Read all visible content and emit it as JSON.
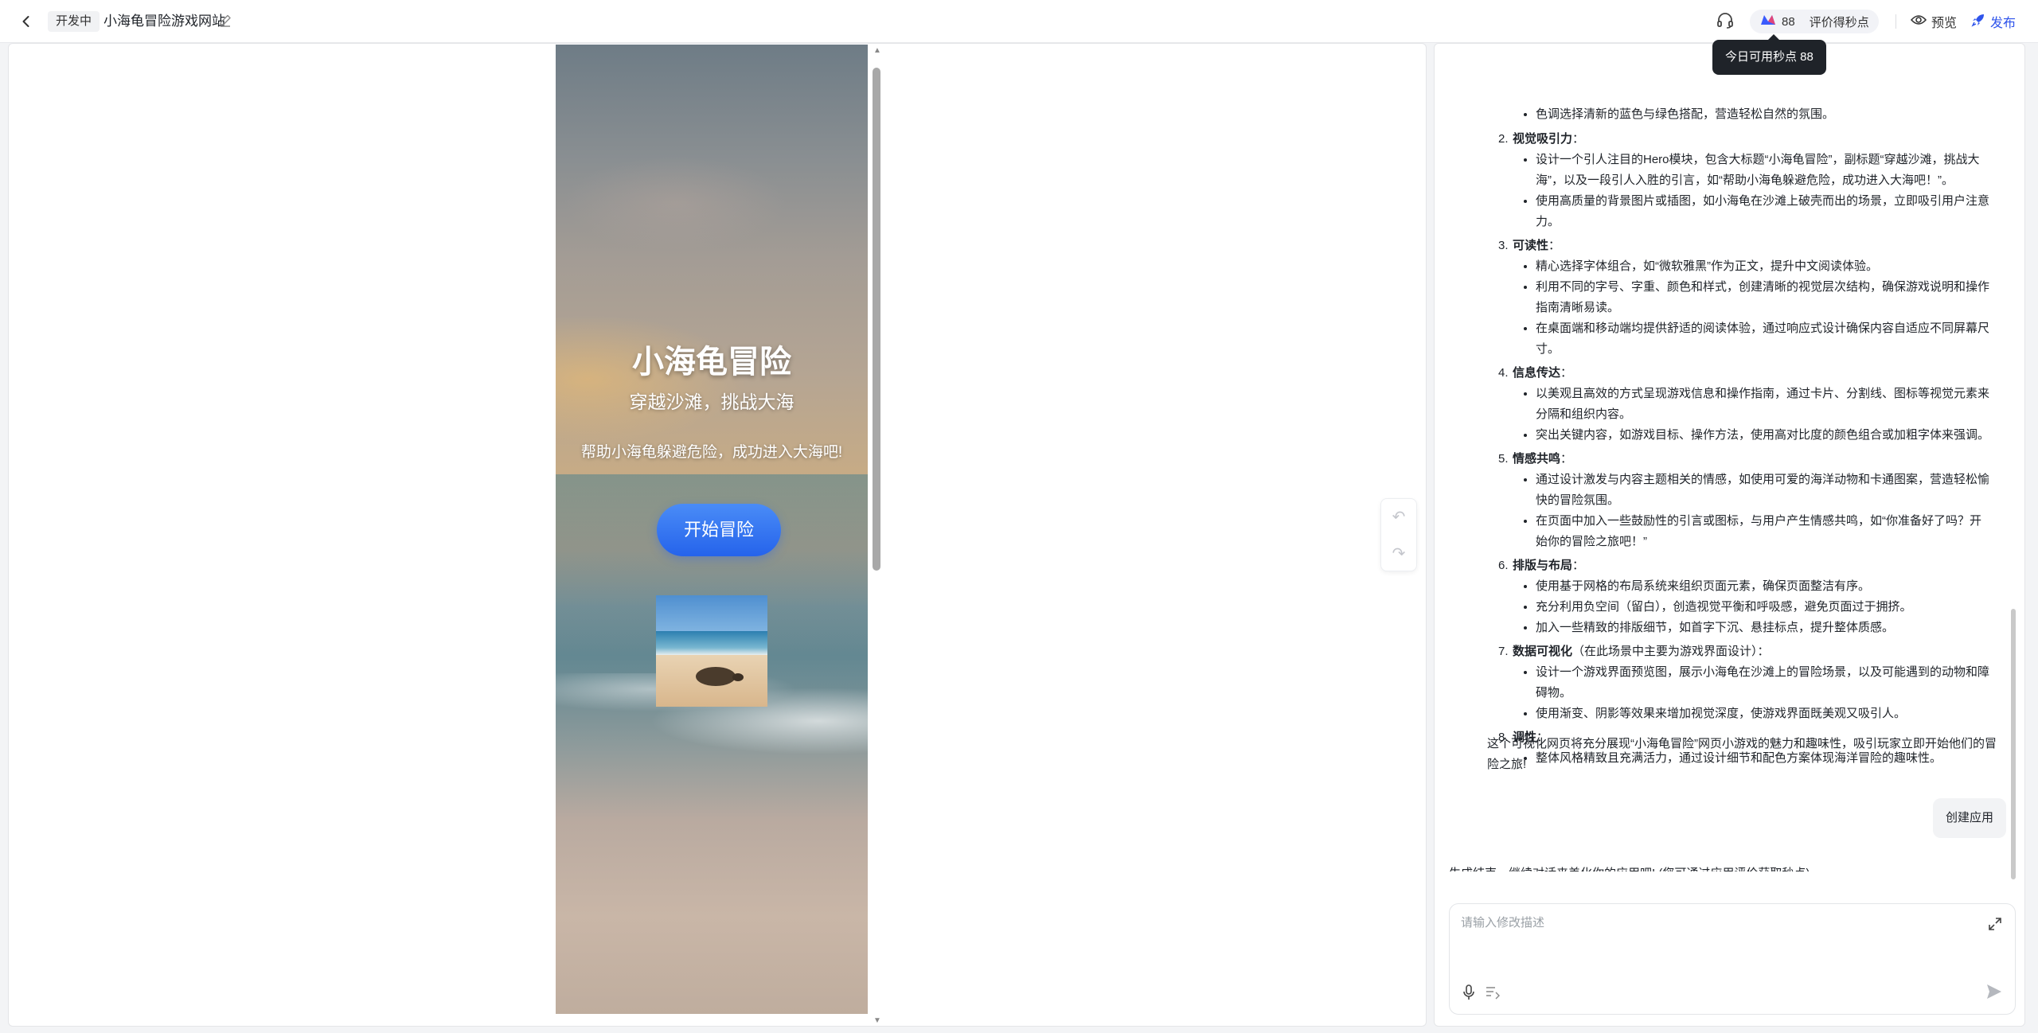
{
  "topbar": {
    "status_badge": "开发中",
    "project_title": "小海龟冒险游戏网站",
    "points_value": "88",
    "points_label": "评价得秒点",
    "preview_label": "预览",
    "publish_label": "发布"
  },
  "tooltip": {
    "text": "今日可用秒点 88"
  },
  "preview": {
    "hero_title": "小海龟冒险",
    "hero_subtitle": "穿越沙滩，挑战大海",
    "hero_quote": "帮助小海龟躲避危险，成功进入大海吧!",
    "hero_button": "开始冒险"
  },
  "chat": {
    "partial_top": "色调选择清新的蓝色与绿色搭配，营造轻松自然的氛围。",
    "sections": [
      {
        "num": "2.",
        "title": "视觉吸引力",
        "suffix": "：",
        "items": [
          "设计一个引人注目的Hero模块，包含大标题“小海龟冒险”，副标题“穿越沙滩，挑战大海”，以及一段引人入胜的引言，如“帮助小海龟躲避危险，成功进入大海吧！”。",
          "使用高质量的背景图片或插图，如小海龟在沙滩上破壳而出的场景，立即吸引用户注意力。"
        ]
      },
      {
        "num": "3.",
        "title": "可读性",
        "suffix": "：",
        "items": [
          "精心选择字体组合，如“微软雅黑”作为正文，提升中文阅读体验。",
          "利用不同的字号、字重、颜色和样式，创建清晰的视觉层次结构，确保游戏说明和操作指南清晰易读。",
          "在桌面端和移动端均提供舒适的阅读体验，通过响应式设计确保内容自适应不同屏幕尺寸。"
        ]
      },
      {
        "num": "4.",
        "title": "信息传达",
        "suffix": "：",
        "items": [
          "以美观且高效的方式呈现游戏信息和操作指南，通过卡片、分割线、图标等视觉元素来分隔和组织内容。",
          "突出关键内容，如游戏目标、操作方法，使用高对比度的颜色组合或加粗字体来强调。"
        ]
      },
      {
        "num": "5.",
        "title": "情感共鸣",
        "suffix": "：",
        "items": [
          "通过设计激发与内容主题相关的情感，如使用可爱的海洋动物和卡通图案，营造轻松愉快的冒险氛围。",
          "在页面中加入一些鼓励性的引言或图标，与用户产生情感共鸣，如“你准备好了吗？开始你的冒险之旅吧！”"
        ]
      },
      {
        "num": "6.",
        "title": "排版与布局",
        "suffix": "：",
        "items": [
          "使用基于网格的布局系统来组织页面元素，确保页面整洁有序。",
          "充分利用负空间（留白），创造视觉平衡和呼吸感，避免页面过于拥挤。",
          "加入一些精致的排版细节，如首字下沉、悬挂标点，提升整体质感。"
        ]
      },
      {
        "num": "7.",
        "title": "数据可视化",
        "suffix": "（在此场景中主要为游戏界面设计）：",
        "items": [
          "设计一个游戏界面预览图，展示小海龟在沙滩上的冒险场景，以及可能遇到的动物和障碍物。",
          "使用渐变、阴影等效果来增加视觉深度，使游戏界面既美观又吸引人。"
        ]
      },
      {
        "num": "8.",
        "title": "调性",
        "suffix": "：",
        "items": [
          "整体风格精致且充满活力，通过设计细节和配色方案体现海洋冒险的趣味性。"
        ]
      }
    ],
    "closing": "这个可视化网页将充分展现“小海龟冒险”网页小游戏的魅力和趣味性，吸引玩家立即开始他们的冒险之旅!",
    "user_message": "创建应用",
    "status": "生成结束，继续对话来美化你的应用吧! (您可通过应用评价获取秒点)",
    "input_placeholder": "请输入修改描述"
  },
  "colors": {
    "accent": "#2f54eb",
    "hero_button": "#2563eb",
    "tooltip_bg": "#1f2329"
  },
  "icons": [
    "back-arrow-icon",
    "edit-pencil-icon",
    "headset-icon",
    "points-logo-icon",
    "eye-icon",
    "rocket-icon",
    "undo-icon",
    "redo-icon",
    "expand-icon",
    "microphone-icon",
    "list-icon",
    "send-icon"
  ]
}
